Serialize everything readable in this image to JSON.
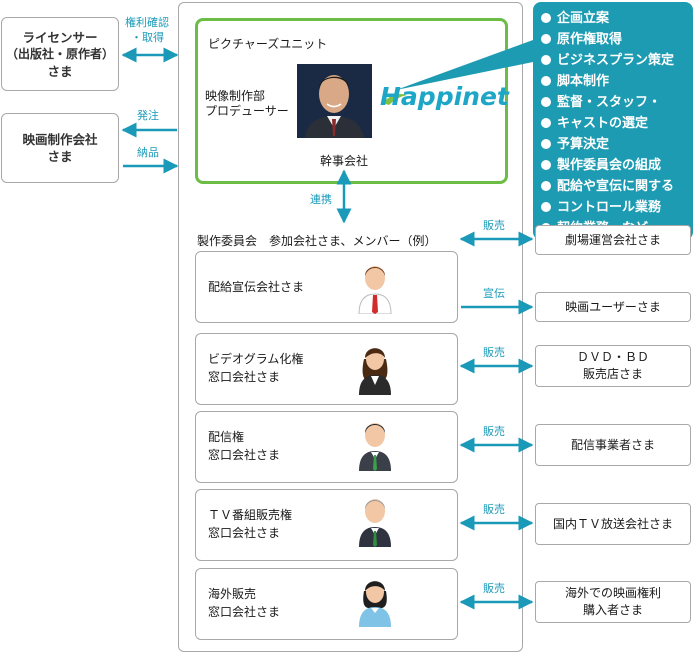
{
  "left_boxes": {
    "licensor": {
      "line1": "ライセンサー",
      "line2": "（出版社・原作者）",
      "line3": "さま"
    },
    "film_company": {
      "line1": "映画制作会社",
      "line2": "さま"
    }
  },
  "arrow_labels": {
    "rights_line1": "権利確認",
    "rights_line2": "・取得",
    "order": "発注",
    "delivery": "納品",
    "cooperation": "連携",
    "sales": "販売",
    "promotion": "宣伝"
  },
  "producer": {
    "title": "ピクチャーズユニット",
    "dept_line1": "映像制作部",
    "dept_line2": "プロデューサー",
    "role": "幹事会社",
    "logo": "Happinet"
  },
  "callout": {
    "items": [
      "企画立案",
      "原作権取得",
      "ビジネスプラン策定",
      "脚本制作",
      "監督・スタッフ・",
      "キャストの選定",
      "予算決定",
      "製作委員会の組成",
      "配給や宣伝に関する",
      "コントロール業務",
      "契約業務　など"
    ]
  },
  "committee": {
    "heading": "製作委員会　参加会社さま、メンバー（例）"
  },
  "members": [
    {
      "line1": "配給宣伝会社さま",
      "line2": ""
    },
    {
      "line1": "ビデオグラム化権",
      "line2": "窓口会社さま"
    },
    {
      "line1": "配信権",
      "line2": "窓口会社さま"
    },
    {
      "line1": "ＴＶ番組販売権",
      "line2": "窓口会社さま"
    },
    {
      "line1": "海外販売",
      "line2": "窓口会社さま"
    }
  ],
  "customers": [
    {
      "line1": "劇場運営会社さま",
      "line2": ""
    },
    {
      "line1": "映画ユーザーさま",
      "line2": ""
    },
    {
      "line1": "ＤＶＤ・ＢＤ",
      "line2": "販売店さま"
    },
    {
      "line1": "配信事業者さま",
      "line2": ""
    },
    {
      "line1": "国内ＴＶ放送会社さま",
      "line2": ""
    },
    {
      "line1": "海外での映画権利",
      "line2": "購入者さま"
    }
  ],
  "colors": {
    "accent": "#1d9bb2",
    "arrow": "#1a9ab8",
    "producer_border": "#6cbd45"
  }
}
